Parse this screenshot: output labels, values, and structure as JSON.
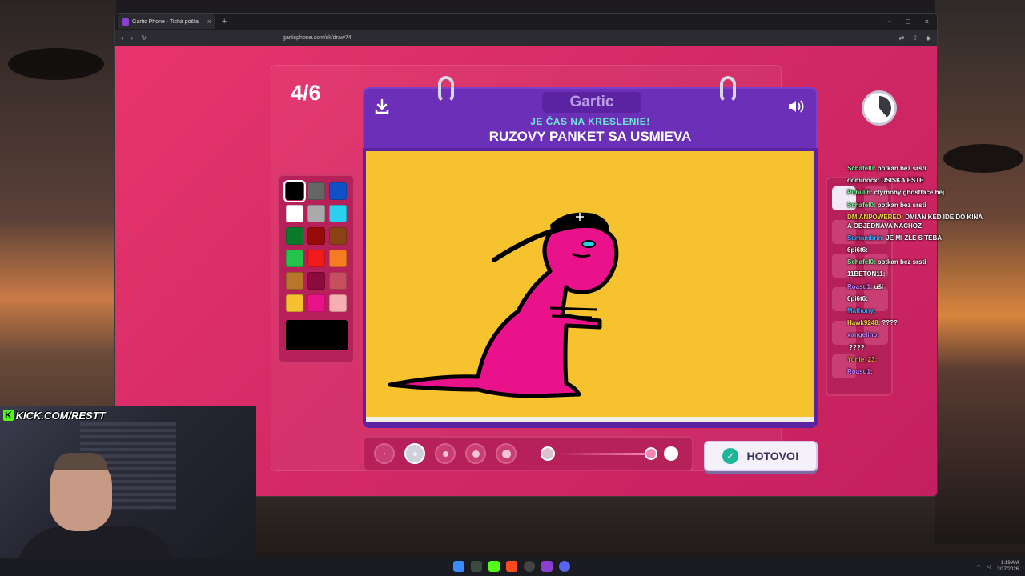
{
  "browser": {
    "tab_title": "Gartic Phone - Tichá pošta",
    "tab_close": "×",
    "new_tab": "+",
    "url": "garticphone.com/sk/draw74",
    "window_controls": [
      "−",
      "□",
      "×"
    ]
  },
  "game": {
    "round": "4/6",
    "brand": "Gartic",
    "subtitle": "JE ČAS NA KRESLENIE!",
    "prompt": "RUZOVY PANKET SA USMIEVA",
    "done_label": "HOTOVO!",
    "palette": [
      {
        "color": "#000000",
        "selected": true
      },
      {
        "color": "#666666"
      },
      {
        "color": "#1151c7"
      },
      {
        "color": "#ffffff"
      },
      {
        "color": "#aaaaaa"
      },
      {
        "color": "#2ad0ee"
      },
      {
        "color": "#0b7a2a"
      },
      {
        "color": "#9a0b0b"
      },
      {
        "color": "#8b4016"
      },
      {
        "color": "#24c44a"
      },
      {
        "color": "#ef1a1a"
      },
      {
        "color": "#f57c22"
      },
      {
        "color": "#b8762a"
      },
      {
        "color": "#8c0a3c"
      },
      {
        "color": "#c75060"
      },
      {
        "color": "#f6c12f"
      },
      {
        "color": "#ea1289"
      },
      {
        "color": "#f7aeb0"
      }
    ],
    "current_color": "#000000",
    "brush_sizes": 5,
    "selected_brush": 2
  },
  "chat": [
    {
      "user": "Schafel0:",
      "msg": "potkan bez srsti",
      "color": "#7ef09a"
    },
    {
      "user": "dominocx:",
      "msg": "USISKA ESTE",
      "color": "#ffffff"
    },
    {
      "user": "Pitbull6:",
      "msg": "ctyrnohy ghostface hej",
      "color": "#7ef09a"
    },
    {
      "user": "Schafel0:",
      "msg": "potkan bez srsti",
      "color": "#7ef09a"
    },
    {
      "user": "DMIANPOWERED:",
      "msg": "DMIAN KED IDE DO KINA A OBJEDNAVA NACHOZ",
      "color": "#f4d34b",
      "wrap": true
    },
    {
      "user": "Samambrin:",
      "msg": "JE MI ZLE S TEBA",
      "color": "#3ba7ff"
    },
    {
      "user": "6pi6t6:",
      "msg": "",
      "color": "#ffffff"
    },
    {
      "user": "Schafel0:",
      "msg": "potkan bez srsti",
      "color": "#7ef09a"
    },
    {
      "user": "11BETON11:",
      "msg": "",
      "color": "#ffffff"
    },
    {
      "user": "Roasu1:",
      "msg": "uši",
      "color": "#c184ff"
    },
    {
      "user": "6pi6t6:",
      "msg": "",
      "color": "#ffffff"
    },
    {
      "user": "Mathony:",
      "msg": "",
      "color": "#3ba7ff"
    },
    {
      "user": "Hawk9248:",
      "msg": "????",
      "color": "#f4d34b"
    },
    {
      "user": "xangelino:",
      "msg": "",
      "color": "#c184ff"
    },
    {
      "user": "",
      "msg": "????",
      "color": "#ffffff"
    },
    {
      "user": "Yonie_23:",
      "msg": "",
      "color": "#ff9b3b"
    },
    {
      "user": "Roasu1:",
      "msg": "",
      "color": "#c184ff"
    }
  ],
  "stream": {
    "kick_badge": "K",
    "kick_text": "KICK.COM/RESTT"
  },
  "taskbar": {
    "time": "1:19 AM",
    "date": "3/17/2026"
  }
}
